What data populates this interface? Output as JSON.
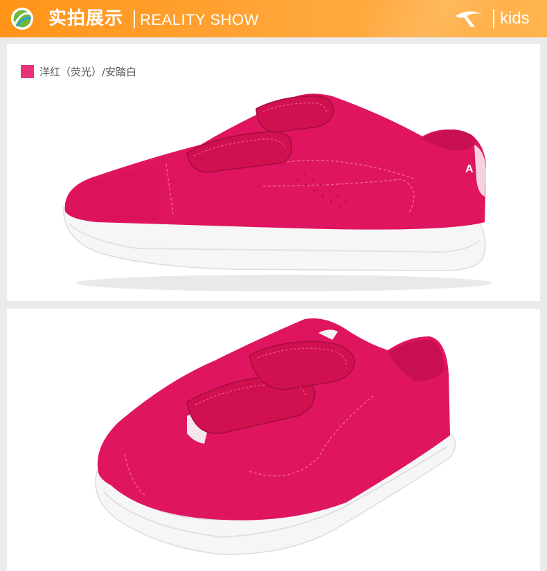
{
  "header": {
    "title_cn": "实拍展示",
    "title_en": "REALITY SHOW",
    "brand": "kids"
  },
  "colors": {
    "header_orange": "#ff9418",
    "shoe_pink": "#e0155f",
    "sole_white": "#f7f7f7",
    "swatch": "#e8337a"
  },
  "variant": {
    "label": "洋红（荧光）/安踏白"
  },
  "icons": [
    "logo-ball-icon",
    "anta-logo-icon"
  ]
}
